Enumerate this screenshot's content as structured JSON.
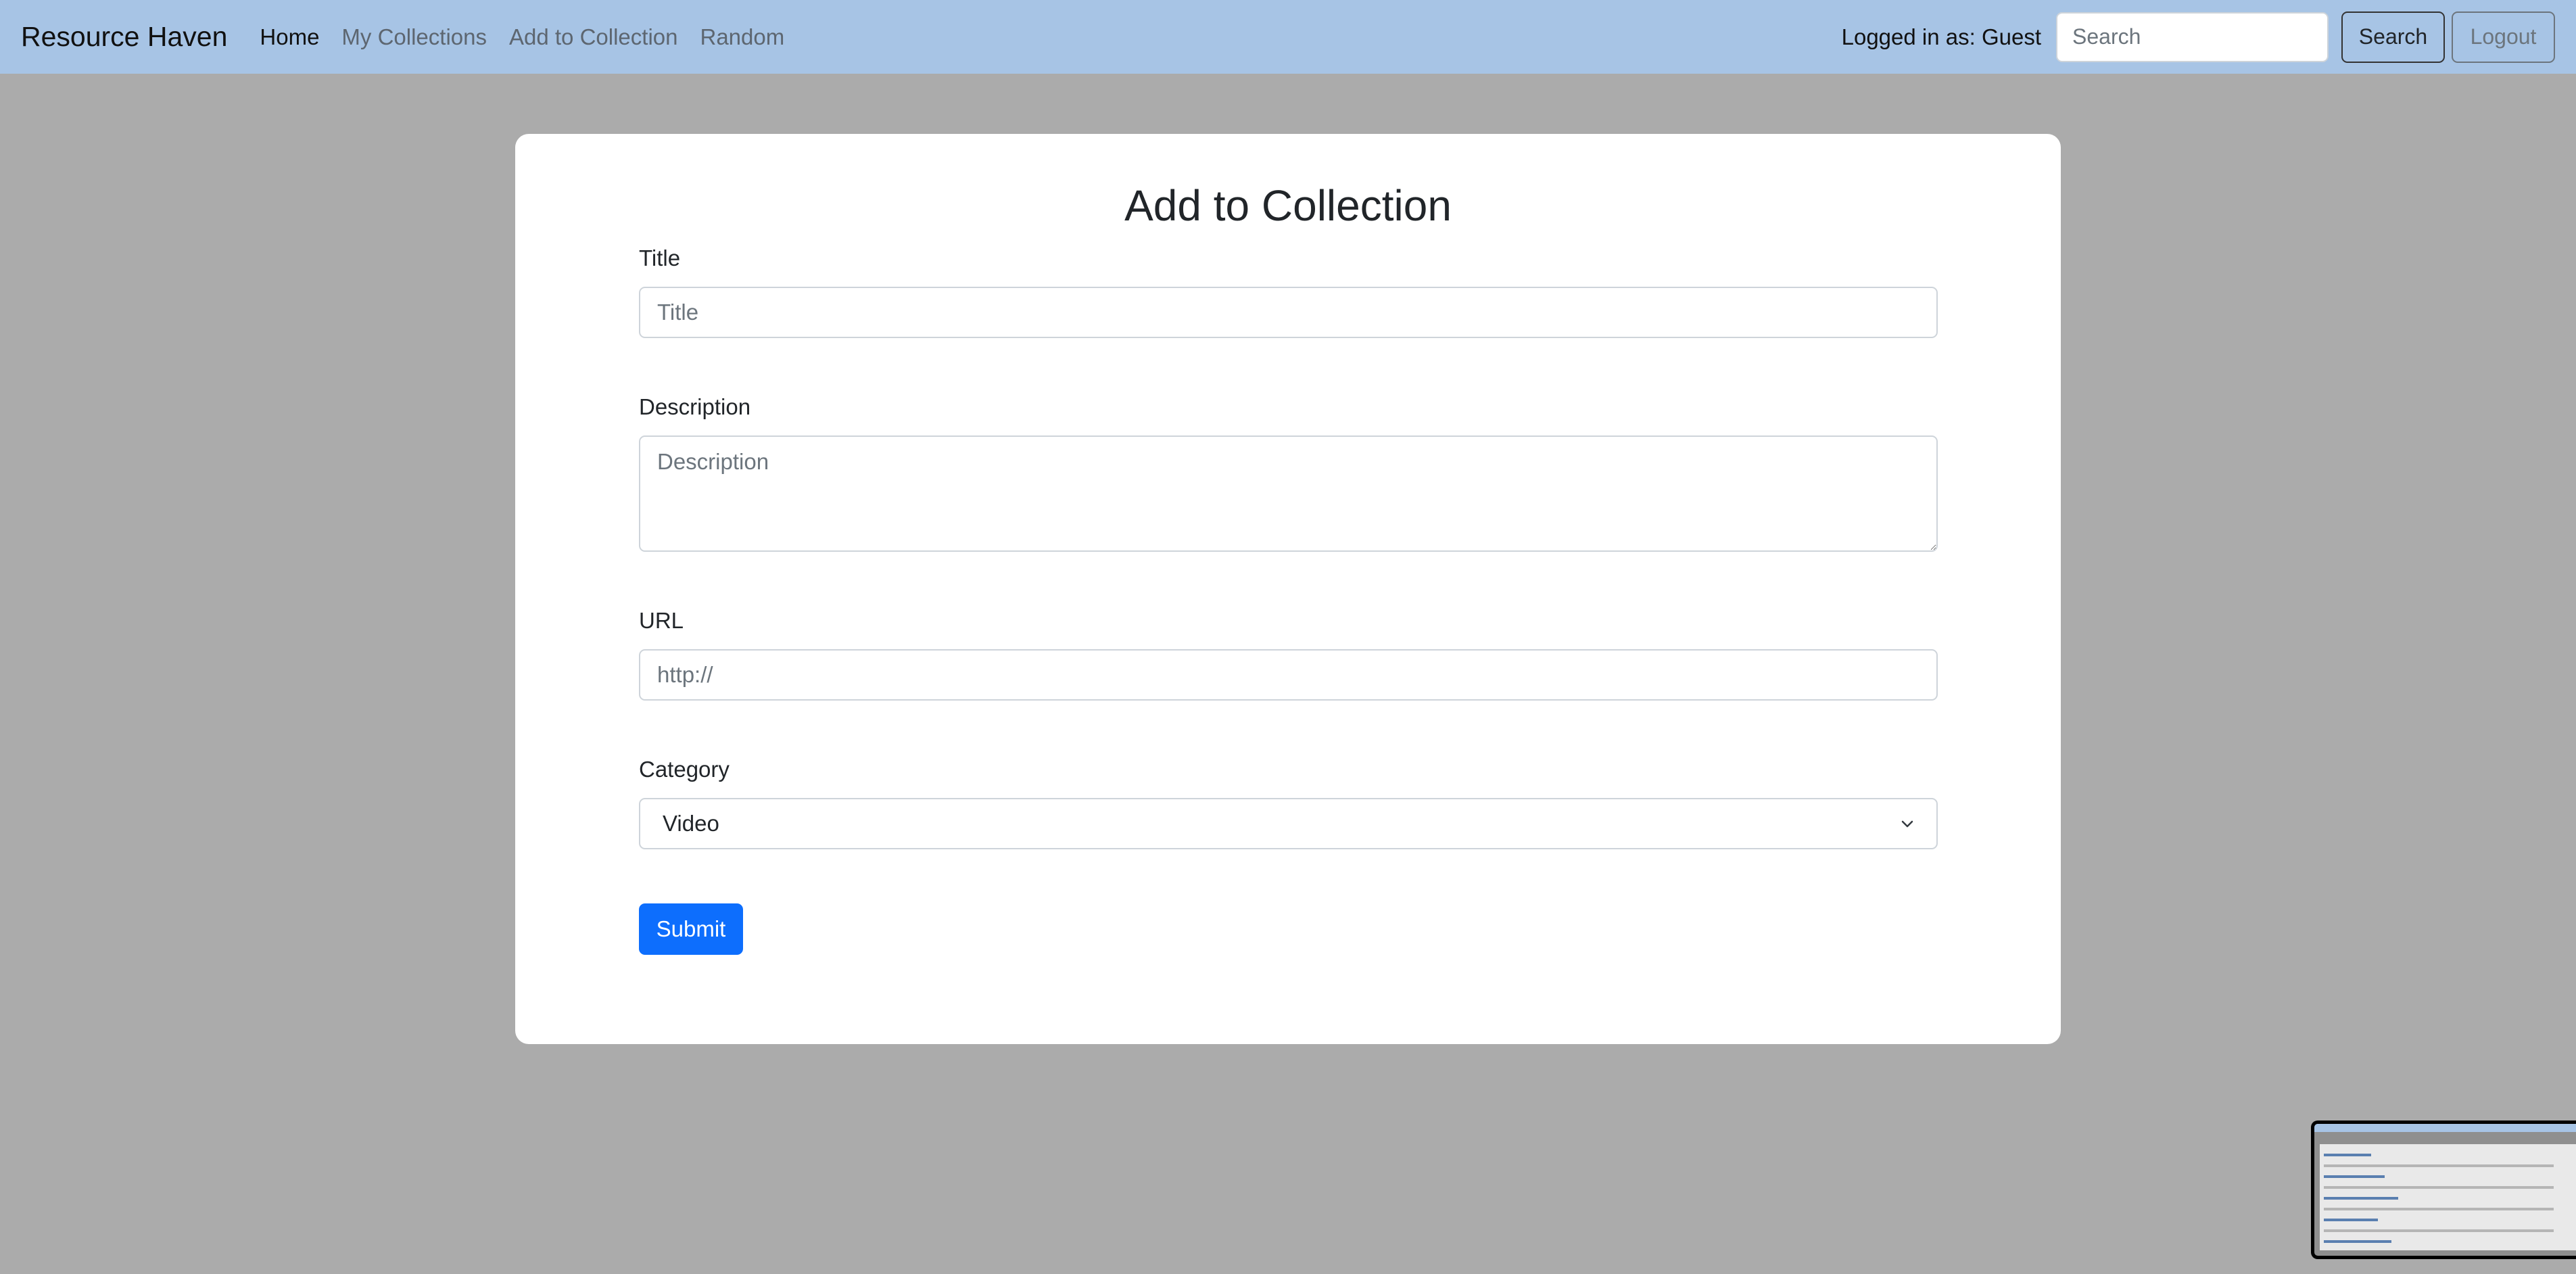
{
  "navbar": {
    "brand": "Resource Haven",
    "links": [
      {
        "label": "Home",
        "active": true
      },
      {
        "label": "My Collections",
        "active": false
      },
      {
        "label": "Add to Collection",
        "active": false
      },
      {
        "label": "Random",
        "active": false
      }
    ],
    "logged_in_text": "Logged in as: Guest",
    "search_placeholder": "Search",
    "search_button": "Search",
    "logout_button": "Logout"
  },
  "form": {
    "heading": "Add to Collection",
    "title_label": "Title",
    "title_placeholder": "Title",
    "description_label": "Description",
    "description_placeholder": "Description",
    "url_label": "URL",
    "url_placeholder": "http://",
    "category_label": "Category",
    "category_selected": "Video",
    "submit_label": "Submit"
  },
  "colors": {
    "navbar_bg": "#a7c4e5",
    "page_bg": "#ababab",
    "primary": "#0d6efd"
  },
  "icons": {
    "select": "chevron-down-icon"
  }
}
